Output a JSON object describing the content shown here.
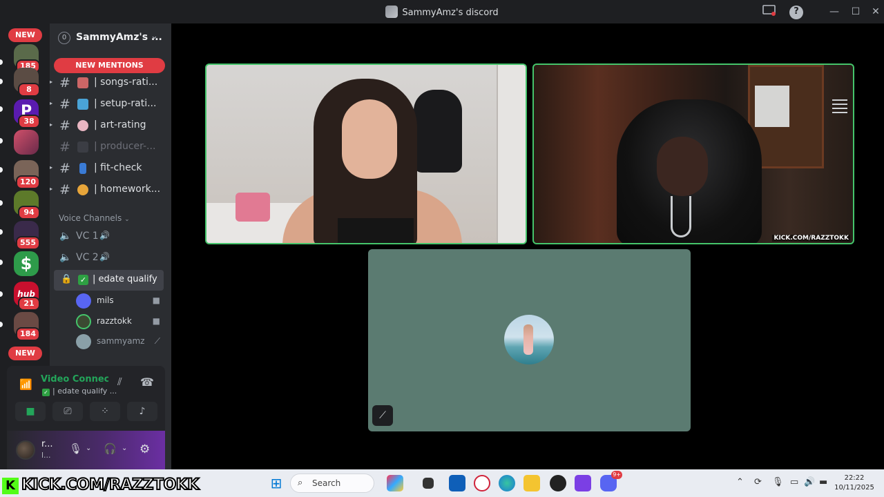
{
  "window": {
    "title": "SammyAmz's discord",
    "help_icon": "?",
    "minimize_icon": "—",
    "maximize_icon": "☐",
    "close_icon": "✕"
  },
  "rail": {
    "new_top": "NEW",
    "new_bottom": "NEW",
    "servers": [
      {
        "badge": "185",
        "color": "#5a6a4a"
      },
      {
        "badge": "8",
        "color": "#5b4c44"
      },
      {
        "badge": "38",
        "color": "#5a1bb0",
        "glyph": "P"
      },
      {
        "badge": "",
        "color": "#d0506a"
      },
      {
        "badge": "120",
        "color": "#7a6458"
      },
      {
        "badge": "94",
        "color": "#5d7a2a"
      },
      {
        "badge": "555",
        "color": "#3a2a4a"
      },
      {
        "badge": "",
        "color": "#2e9b4a",
        "glyph": "$"
      },
      {
        "badge": "21",
        "color": "#c8102e",
        "glyph": "hub"
      },
      {
        "badge": "184",
        "color": "#6a4a44"
      }
    ]
  },
  "sidebar": {
    "server_number": "0",
    "server_name": "SammyAmz's ...",
    "new_mentions": "NEW MENTIONS",
    "channels": [
      {
        "label": "| songs-rati...",
        "emoji_color": "#c66"
      },
      {
        "label": "| setup-rati...",
        "emoji_color": "#4aa3d6"
      },
      {
        "label": "| art-rating",
        "emoji_color": "#e8b6c2"
      },
      {
        "label": "| producer-...",
        "emoji_color": "#3b3d44"
      },
      {
        "label": "| fit-check",
        "emoji_color": "#3a7bd5"
      },
      {
        "label": "| homework...",
        "emoji_color": "#e7a53a"
      }
    ],
    "voice_header": "Voice Channels",
    "voice_channels": [
      {
        "label": "VC 1"
      },
      {
        "label": "VC 2"
      }
    ],
    "active_voice": "| edate qualify",
    "members": [
      {
        "name": "mils",
        "avatar_color": "#5865f2",
        "status_icon": "camera-icon"
      },
      {
        "name": "razztokk",
        "avatar_color": "#3b4a32",
        "status_icon": "camera-icon"
      },
      {
        "name": "sammyamz",
        "avatar_color": "#8aa0a8",
        "status_icon": "mic-muted-icon"
      }
    ]
  },
  "voice_panel": {
    "title": "Video Connected",
    "subtitle": "| edate qualify ..."
  },
  "user_panel": {
    "name": "r...",
    "status": "l..."
  },
  "taskbar": {
    "search_placeholder": "Search",
    "time": "22:22",
    "date": "10/11/2025",
    "discord_badge": "9+"
  },
  "overlay": {
    "kick_letter": "K",
    "kick_text": "KICK.COM/RAZZTOKK",
    "tile_kick_text": "KICK.COM/RAZZTOKK"
  }
}
